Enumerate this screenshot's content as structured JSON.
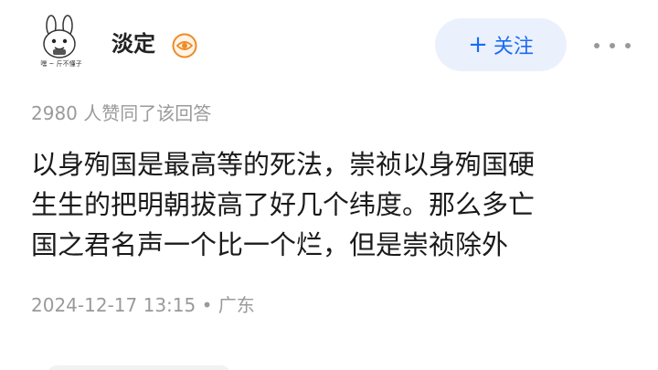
{
  "header": {
    "avatar_caption": "嘿 ~ 斤不懂子",
    "username": "淡定",
    "badge_icon": "eye-badge-icon",
    "follow_label": "关注",
    "follow_icon": "plus-icon",
    "more_icon": "more-dots-icon"
  },
  "answer": {
    "likes_text": "2980 人赞同了该回答",
    "body_lines": [
      "以身殉国是最高等的死法，崇祯以身殉国硬",
      "生生的把明朝拔高了好几个纬度。那么多亡",
      "国之君名声一个比一个烂，但是崇祯除外"
    ],
    "date": "2024-12-17 13:15",
    "separator": "•",
    "location": "广东"
  },
  "colors": {
    "accent": "#1c6bf2",
    "follow_bg": "#eaf1fd",
    "muted_text": "#9a9a9a",
    "badge_orange": "#f08a24"
  }
}
